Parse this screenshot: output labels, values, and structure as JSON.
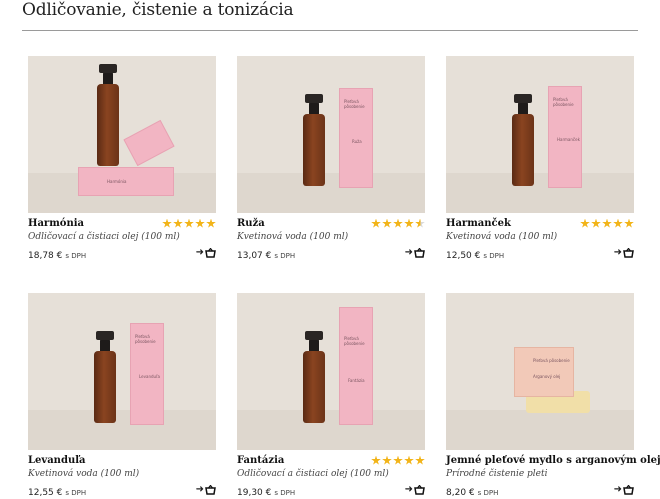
{
  "page": {
    "title": "Odličovanie, čistenie a tonizácia"
  },
  "colors": {
    "star": "#f2b418",
    "box_pink": "#f2b5c3",
    "bottle_amber": "#7a3a1a",
    "photo_bg": "#e6e0d8"
  },
  "products": [
    {
      "name": "Harmónia",
      "description": "Odličovací a čistiaci olej (100 ml)",
      "price": "18,78 €",
      "vat": "s DPH",
      "rating": 5,
      "stars": [
        1,
        1,
        1,
        1,
        1
      ],
      "box_text": "Harmónia",
      "cart_icon": "add-to-cart-icon"
    },
    {
      "name": "Ruža",
      "description": "Kvetinová voda (100 ml)",
      "price": "13,07 €",
      "vat": "s DPH",
      "rating": 4.5,
      "stars": [
        1,
        1,
        1,
        1,
        0.5
      ],
      "box_title": "Pleťová\npôsobenie",
      "box_text": "Ruža",
      "cart_icon": "add-to-cart-icon"
    },
    {
      "name": "Harmanček",
      "description": "Kvetinová voda (100 ml)",
      "price": "12,50 €",
      "vat": "s DPH",
      "rating": 5,
      "stars": [
        1,
        1,
        1,
        1,
        1
      ],
      "box_title": "Pleťová\npôsobenie",
      "box_text": "Harmanček",
      "cart_icon": "add-to-cart-icon"
    },
    {
      "name": "Levanduľa",
      "description": "Kvetinová voda (100 ml)",
      "price": "12,55 €",
      "vat": "s DPH",
      "rating": 0,
      "stars": [],
      "box_title": "Pleťová\npôsobenie",
      "box_text": "Levanduľa",
      "cart_icon": "add-to-cart-icon"
    },
    {
      "name": "Fantázia",
      "description": "Odličovací a čistiaci olej (100 ml)",
      "price": "19,30 €",
      "vat": "s DPH",
      "rating": 5,
      "stars": [
        1,
        1,
        1,
        1,
        1
      ],
      "box_title": "Pleťová\npôsobenie",
      "box_text": "Fantázia",
      "cart_icon": "add-to-cart-icon"
    },
    {
      "name": "Jemné pleťové mydlo s arganovým olejom",
      "description": "Prírodné čistenie pleti",
      "price": "8,20 €",
      "vat": "s DPH",
      "rating": 0,
      "stars": [],
      "box_title": "Pleťová\npôsobenie",
      "box_text": "Arganový\nolej",
      "cart_icon": "add-to-cart-icon"
    }
  ]
}
